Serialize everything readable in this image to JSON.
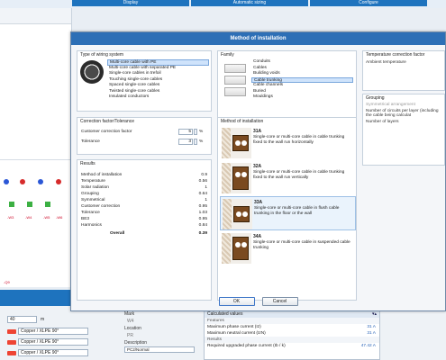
{
  "topbar": {
    "tabs": [
      "Display",
      "Automatic sizing",
      "Configure"
    ]
  },
  "dialog": {
    "title": "Method of installation",
    "wiring": {
      "title": "Type of wiring system",
      "items": [
        "Multi-core cable with PE",
        "Multi-core cable with separated PE",
        "Single-core cables in trefoil",
        "Touching single-core cables",
        "Spaced single-core cables",
        "Twisted single-core cables",
        "Insulated conductors"
      ],
      "selected_index": 0
    },
    "family": {
      "title": "Family",
      "items": [
        "Conduits",
        "Cables",
        "Building voids",
        "Cable trunking",
        "Cable channels",
        "Buried",
        "Mouldings"
      ],
      "selected_index": 3
    },
    "temperature": {
      "title": "Temperature correction factor",
      "ambient_label": "Ambient temperature"
    },
    "grouping": {
      "title": "Grouping",
      "arrangement_label": "Symmetrical arrangement",
      "circuits_label": "Number of circuits per layer (including the cable being calculat",
      "layers_label": "Number of layers"
    },
    "correction": {
      "title": "Correction factor/Tolerance",
      "customer_label": "Customer correction factor",
      "customer_value": "5",
      "tolerance_label": "Tolerance",
      "tolerance_value": "3",
      "unit": "%"
    },
    "results": {
      "title": "Results",
      "rows": [
        {
          "label": "Method of installation",
          "value": "0.9"
        },
        {
          "label": "Temperature",
          "value": "0.56"
        },
        {
          "label": "Solar radiation",
          "value": "1"
        },
        {
          "label": "Grouping",
          "value": "0.64"
        },
        {
          "label": "Symmetrical",
          "value": "1"
        },
        {
          "label": "Customer correction",
          "value": "0.95"
        },
        {
          "label": "Tolerance",
          "value": "1.03"
        },
        {
          "label": "BE3",
          "value": "0.95"
        },
        {
          "label": "Harmonics",
          "value": "0.84"
        }
      ],
      "overall_label": "Overall",
      "overall_value": "0.39"
    },
    "method": {
      "title": "Method of installation",
      "options": [
        {
          "code": "31A",
          "desc": "Single-core or multi-core cable in cable trunking fixed to the wall run horizontally"
        },
        {
          "code": "32A",
          "desc": "Single-core or multi-core cable in cable trunking fixed to the wall run vertically"
        },
        {
          "code": "33A",
          "desc": "Single-core or multi-core cable in flush cable trunking in the floor or the wall"
        },
        {
          "code": "34A",
          "desc": "Single-core or multi-core cable in suspended cable trunking"
        }
      ],
      "selected_index": 2
    },
    "ok_label": "OK",
    "cancel_label": "Cancel"
  },
  "bottom": {
    "length_value": "40",
    "length_unit": "m",
    "cables": [
      "Copper / XLPE 90°",
      "Copper / XLPE 90°",
      "Copper / XLPE 90°"
    ],
    "props": {
      "mark_label": "Mark",
      "mark_value": "W4",
      "location_label": "Location",
      "location_value": "PR",
      "description_label": "Description",
      "description_value": "PC2/Normal"
    },
    "calc": {
      "header": "Calculated values",
      "pin": "▾▴",
      "features_label": "Features",
      "rows": [
        {
          "label": "Maximum phase current (Iz)",
          "value": "31 A"
        },
        {
          "label": "Maximum neutral current (IzN)",
          "value": "31 A"
        }
      ],
      "results_label": "Results",
      "required_label": "Required upgraded phase current (Ib / k)",
      "required_value": "47.42 A"
    }
  },
  "schematic": {
    "labels": [
      "-W3",
      "-W4",
      "-W5",
      "-W6",
      "-Q9"
    ]
  }
}
